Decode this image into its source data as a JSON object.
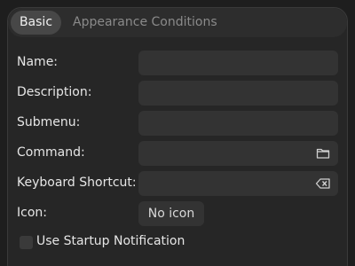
{
  "tabs": [
    {
      "label": "Basic",
      "active": true
    },
    {
      "label": "Appearance Conditions",
      "active": false
    }
  ],
  "form": {
    "name": {
      "label": "Name:",
      "value": ""
    },
    "description": {
      "label": "Description:",
      "value": ""
    },
    "submenu": {
      "label": "Submenu:",
      "value": ""
    },
    "command": {
      "label": "Command:",
      "value": "",
      "icon": "folder-icon"
    },
    "keyboard_shortcut": {
      "label": "Keyboard Shortcut:",
      "value": "",
      "icon": "clear-backspace-icon"
    },
    "icon": {
      "label": "Icon:",
      "button_label": "No icon"
    },
    "startup_notification": {
      "label": "Use Startup Notification",
      "checked": false
    }
  },
  "colors": {
    "background": "#1e1e1e",
    "panel": "#262626",
    "field": "#333333",
    "active_tab": "#474747",
    "inactive_text": "#8a8a8a"
  }
}
